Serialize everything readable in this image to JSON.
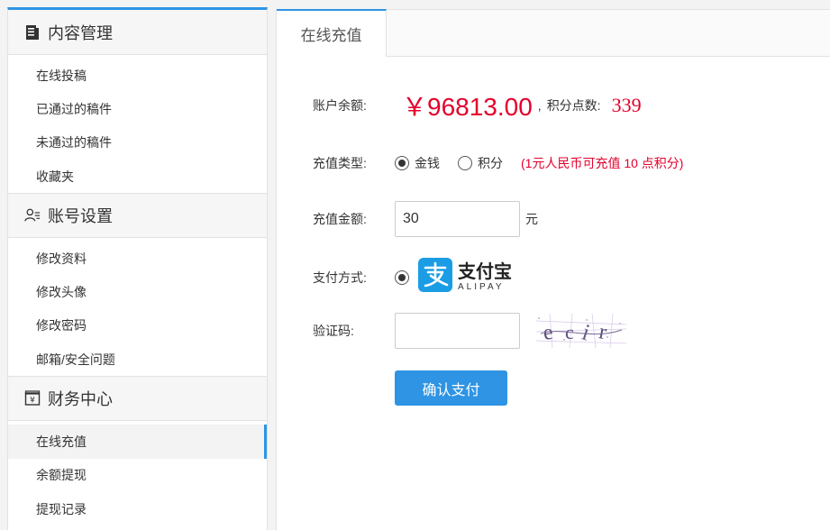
{
  "sidebar": {
    "groups": [
      {
        "title": "内容管理",
        "icon": "document-icon",
        "items": [
          "在线投稿",
          "已通过的稿件",
          "未通过的稿件",
          "收藏夹"
        ]
      },
      {
        "title": "账号设置",
        "icon": "user-settings-icon",
        "items": [
          "修改资料",
          "修改头像",
          "修改密码",
          "邮箱/安全问题"
        ]
      },
      {
        "title": "财务中心",
        "icon": "wallet-icon",
        "items": [
          "在线充值",
          "余额提现",
          "提现记录"
        ]
      }
    ],
    "active_item": "在线充值"
  },
  "main": {
    "tab_label": "在线充值",
    "balance": {
      "label": "账户余额:",
      "value": "￥96813.00",
      "separator": ",",
      "points_label": "积分点数:",
      "points_value": "339"
    },
    "recharge_type": {
      "label": "充值类型:",
      "options": [
        "金钱",
        "积分"
      ],
      "selected": "金钱",
      "note": "(1元人民币可充值 10 点积分)"
    },
    "amount": {
      "label": "充值金额:",
      "value": "30",
      "unit": "元"
    },
    "payment": {
      "label": "支付方式:",
      "method_cn": "支付宝",
      "method_en": "ALIPAY"
    },
    "captcha": {
      "label": "验证码:",
      "value": "",
      "code": "ecir"
    },
    "submit_label": "确认支付"
  },
  "colors": {
    "accent": "#2e94e3",
    "alipay": "#1a9de5",
    "price": "#e4002b"
  }
}
